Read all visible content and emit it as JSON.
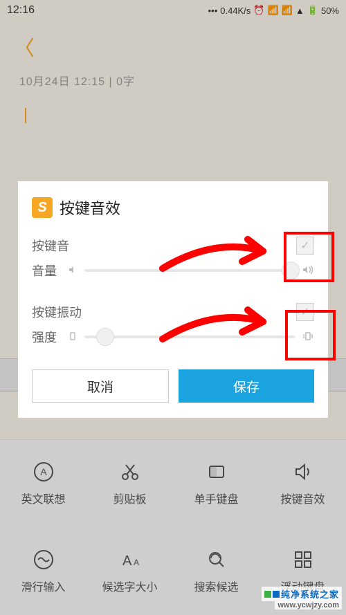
{
  "status": {
    "time": "12:16",
    "net_speed": "0.44K/s",
    "battery": "50%"
  },
  "note": {
    "meta": "10月24日  12:15  |  0字"
  },
  "dialog": {
    "title": "按键音效",
    "sound_label": "按键音",
    "volume_label": "音量",
    "vibration_label": "按键振动",
    "intensity_label": "强度",
    "cancel": "取消",
    "save": "保存"
  },
  "keyboard_menu": {
    "items": [
      {
        "label": "英文联想",
        "icon": "A"
      },
      {
        "label": "剪贴板",
        "icon": "scissors"
      },
      {
        "label": "单手键盘",
        "icon": "rect"
      },
      {
        "label": "按键音效",
        "icon": "speaker"
      },
      {
        "label": "滑行输入",
        "icon": "wave"
      },
      {
        "label": "候选字大小",
        "icon": "Aa"
      },
      {
        "label": "搜索候选",
        "icon": "search"
      },
      {
        "label": "浮动键盘",
        "icon": "grid"
      }
    ]
  },
  "watermark": {
    "name": "纯净系统之家",
    "url": "www.ycwjzy.com"
  }
}
